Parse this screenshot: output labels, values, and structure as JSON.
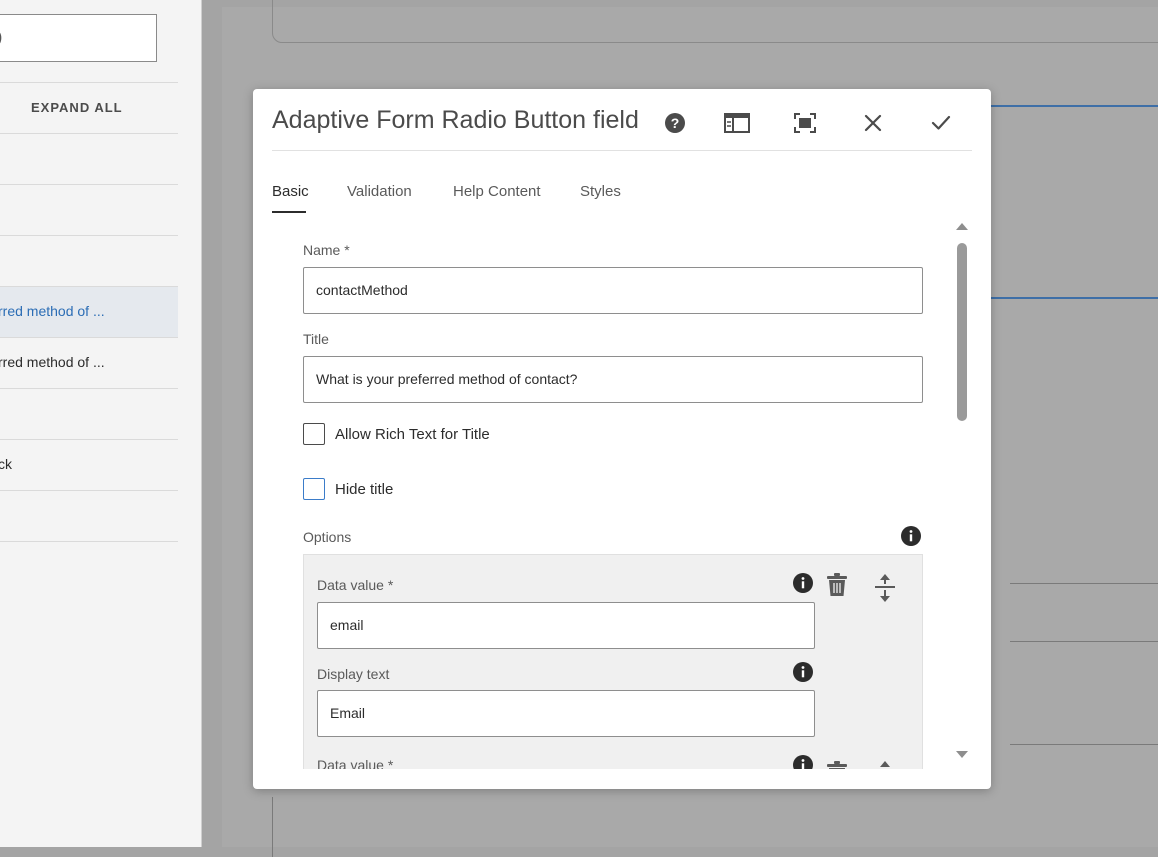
{
  "sidebar": {
    "expand_all": "EXPAND ALL",
    "items": [
      {
        "label": "rred method of ..."
      },
      {
        "label": "rred method of ..."
      },
      {
        "label": "ck"
      }
    ]
  },
  "dialog": {
    "title": "Adaptive Form Radio Button field",
    "header_icons": [
      "help-icon",
      "layout-icon",
      "fullscreen-icon",
      "close-icon",
      "checkmark-icon"
    ],
    "tabs": [
      {
        "label": "Basic",
        "active": true
      },
      {
        "label": "Validation"
      },
      {
        "label": "Help Content"
      },
      {
        "label": "Styles"
      }
    ],
    "fields": {
      "name": {
        "label": "Name *",
        "value": "contactMethod"
      },
      "title": {
        "label": "Title",
        "value": "What is your preferred method of contact?"
      },
      "allow_rich_text": {
        "label": "Allow Rich Text for Title",
        "checked": false
      },
      "hide_title": {
        "label": "Hide title",
        "checked": false
      }
    },
    "options": {
      "label": "Options",
      "items": [
        {
          "data_value_label": "Data value *",
          "data_value": "email",
          "display_text_label": "Display text",
          "display_text": "Email"
        },
        {
          "data_value_label": "Data value *"
        }
      ]
    }
  },
  "colors": {
    "accent": "#3b7cc9",
    "selected_text": "#2b6db5",
    "overlay": "#a4a4a4"
  }
}
